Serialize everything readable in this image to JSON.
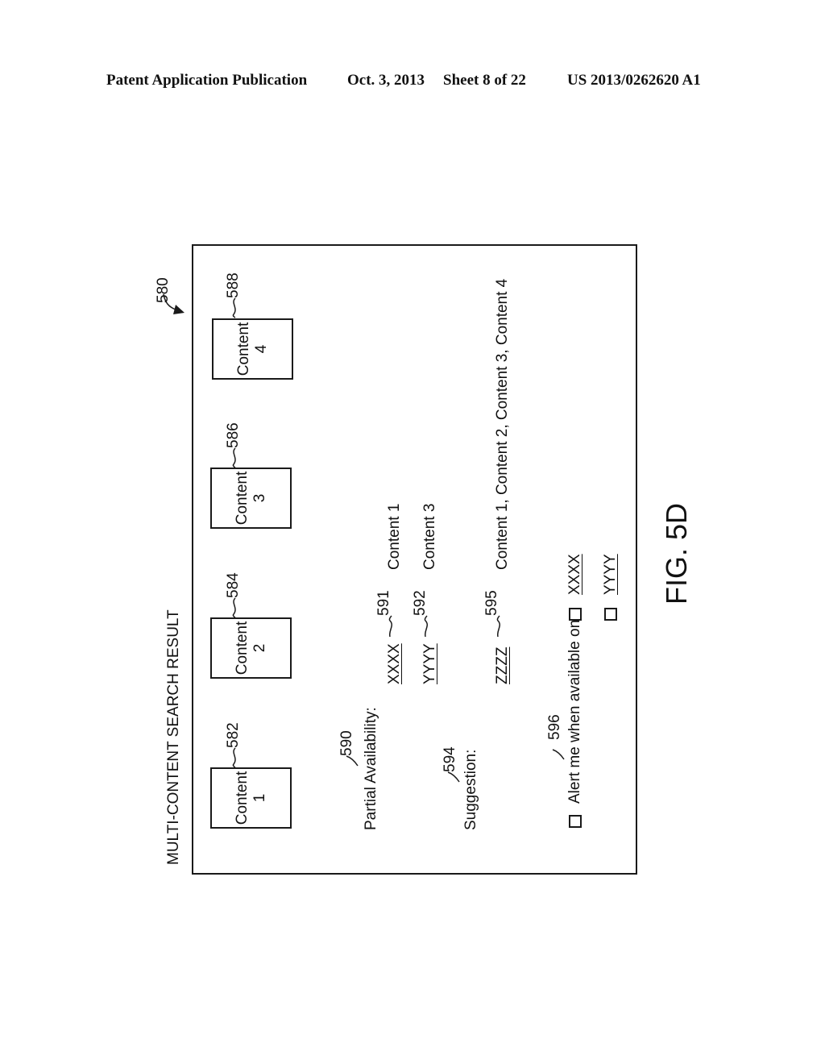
{
  "header": {
    "publication": "Patent Application Publication",
    "date": "Oct. 3, 2013",
    "sheet": "Sheet 8 of 22",
    "number": "US 2013/0262620 A1"
  },
  "figure": {
    "label": "FIG. 5D",
    "ref": "580",
    "title": "MULTI-CONTENT SEARCH RESULT",
    "contents": [
      {
        "line1": "Content",
        "line2": "1",
        "ref": "582"
      },
      {
        "line1": "Content",
        "line2": "2",
        "ref": "584"
      },
      {
        "line1": "Content",
        "line2": "3",
        "ref": "586"
      },
      {
        "line1": "Content",
        "line2": "4",
        "ref": "588"
      }
    ],
    "partial": {
      "label": "Partial Availability:",
      "ref": "590",
      "items": [
        {
          "service": "XXXX",
          "ref": "591",
          "content": "Content 1"
        },
        {
          "service": "YYYY",
          "ref": "592",
          "content": "Content 3"
        }
      ]
    },
    "suggestion": {
      "label": "Suggestion:",
      "ref": "594",
      "service": "ZZZZ",
      "service_ref": "595",
      "content": "Content 1, Content 2, Content 3, Content 4"
    },
    "alert": {
      "label": "Alert me when available on",
      "ref": "596",
      "options": [
        "XXXX",
        "YYYY"
      ]
    }
  }
}
